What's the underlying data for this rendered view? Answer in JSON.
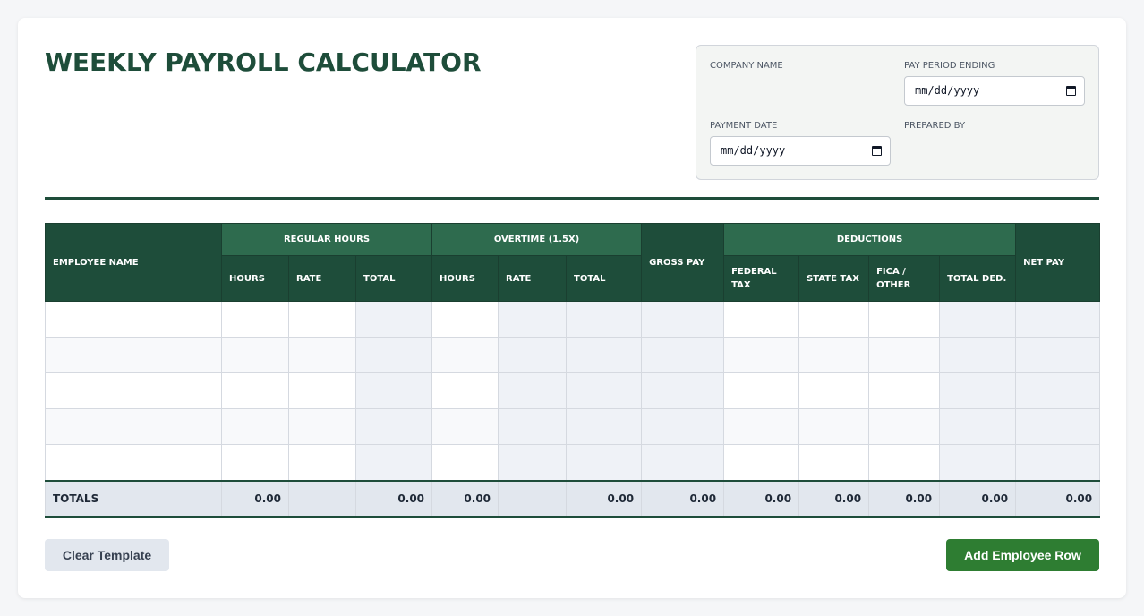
{
  "title": "WEEKLY PAYROLL CALCULATOR",
  "meta": {
    "company_name_label": "COMPANY NAME",
    "pay_period_label": "PAY PERIOD ENDING",
    "pay_period_value": "mm/dd/yyyy",
    "payment_date_label": "PAYMENT DATE",
    "payment_date_value": "mm/dd/yyyy",
    "prepared_by_label": "PREPARED BY"
  },
  "table": {
    "employee_name": "EMPLOYEE NAME",
    "regular_hours": "REGULAR HOURS",
    "overtime": "OVERTIME (1.5X)",
    "gross_pay": "GROSS PAY",
    "deductions": "DEDUCTIONS",
    "net_pay": "NET PAY",
    "sub": {
      "reg_hours": "HOURS",
      "reg_rate": "RATE",
      "reg_total": "TOTAL",
      "ot_hours": "HOURS",
      "ot_rate": "RATE",
      "ot_total": "TOTAL",
      "federal_tax_1": "FEDERAL",
      "federal_tax_2": "TAX",
      "state_tax": "STATE TAX",
      "fica_1": "FICA /",
      "fica_2": "OTHER",
      "total_ded": "TOTAL DED."
    },
    "totals": {
      "label": "TOTALS",
      "reg_hours": "0.00",
      "reg_total": "0.00",
      "ot_hours": "0.00",
      "ot_total": "0.00",
      "gross_pay": "0.00",
      "federal_tax": "0.00",
      "state_tax": "0.00",
      "fica": "0.00",
      "total_ded": "0.00",
      "net_pay": "0.00"
    }
  },
  "buttons": {
    "clear": "Clear Template",
    "add": "Add Employee Row"
  },
  "colors": {
    "brand_green": "#1e4d3a",
    "group_header": "#2e6b4e",
    "add_button": "#2e7d32"
  }
}
